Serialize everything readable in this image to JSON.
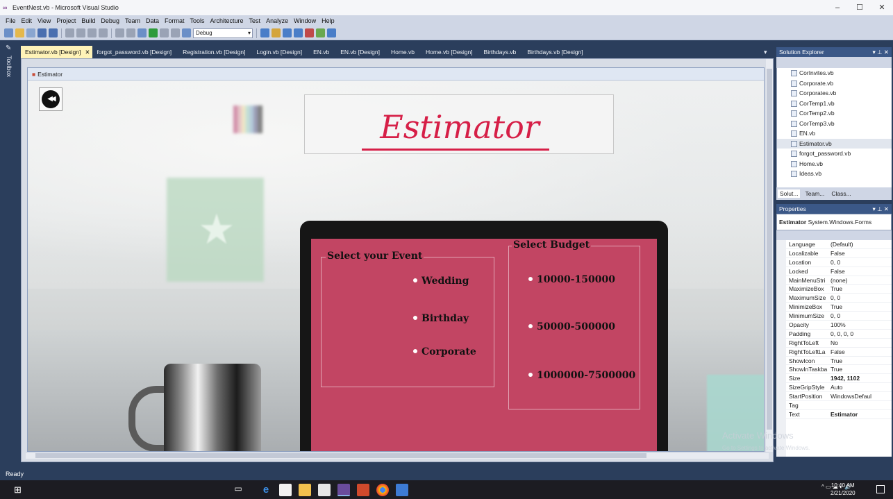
{
  "window": {
    "title": "EventNest.vb - Microsoft Visual Studio",
    "controls": [
      "–",
      "☐",
      "✕"
    ]
  },
  "menu": [
    "File",
    "Edit",
    "View",
    "Project",
    "Build",
    "Debug",
    "Team",
    "Data",
    "Format",
    "Tools",
    "Architecture",
    "Test",
    "Analyze",
    "Window",
    "Help"
  ],
  "toolbar": {
    "config": "Debug"
  },
  "toolbox_label": "Toolbox",
  "tabs": [
    {
      "label": "Estimator.vb [Design]",
      "active": true
    },
    {
      "label": "forgot_password.vb [Design]"
    },
    {
      "label": "Registration.vb [Design]"
    },
    {
      "label": "Login.vb [Design]"
    },
    {
      "label": "EN.vb"
    },
    {
      "label": "EN.vb [Design]"
    },
    {
      "label": "Home.vb"
    },
    {
      "label": "Home.vb [Design]"
    },
    {
      "label": "Birthdays.vb"
    },
    {
      "label": "Birthdays.vb [Design]"
    }
  ],
  "form": {
    "window_title": "Estimator",
    "heading": "Estimator",
    "event_group": {
      "legend": "Select your Event",
      "options": [
        "Wedding",
        "Birthday",
        "Corporate"
      ]
    },
    "budget_group": {
      "legend": "Select Budget",
      "options": [
        "10000-150000",
        "50000-500000",
        "1000000-7500000"
      ]
    }
  },
  "solution_explorer": {
    "title": "Solution Explorer",
    "items": [
      "CorInvites.vb",
      "Corporate.vb",
      "Corporates.vb",
      "CorTemp1.vb",
      "CorTemp2.vb",
      "CorTemp3.vb",
      "EN.vb",
      "Estimator.vb",
      "forgot_password.vb",
      "Home.vb",
      "Ideas.vb"
    ],
    "selected": "Estimator.vb",
    "bottom_tabs": [
      "Solut...",
      "Team...",
      "Class..."
    ]
  },
  "properties": {
    "title": "Properties",
    "object_name": "Estimator",
    "object_type": "System.Windows.Forms",
    "rows": [
      {
        "name": "Language",
        "value": "(Default)"
      },
      {
        "name": "Localizable",
        "value": "False"
      },
      {
        "name": "Location",
        "value": "0, 0"
      },
      {
        "name": "Locked",
        "value": "False"
      },
      {
        "name": "MainMenuStri",
        "value": "(none)"
      },
      {
        "name": "MaximizeBox",
        "value": "True"
      },
      {
        "name": "MaximumSize",
        "value": "0, 0"
      },
      {
        "name": "MinimizeBox",
        "value": "True"
      },
      {
        "name": "MinimumSize",
        "value": "0, 0"
      },
      {
        "name": "Opacity",
        "value": "100%"
      },
      {
        "name": "Padding",
        "value": "0, 0, 0, 0"
      },
      {
        "name": "RightToLeft",
        "value": "No"
      },
      {
        "name": "RightToLeftLa",
        "value": "False"
      },
      {
        "name": "ShowIcon",
        "value": "True"
      },
      {
        "name": "ShowInTaskba",
        "value": "True"
      },
      {
        "name": "Size",
        "value": "1942, 1102",
        "bold": true
      },
      {
        "name": "SizeGripStyle",
        "value": "Auto"
      },
      {
        "name": "StartPosition",
        "value": "WindowsDefaul"
      },
      {
        "name": "Tag",
        "value": ""
      },
      {
        "name": "Text",
        "value": "Estimator",
        "bold": true
      }
    ]
  },
  "watermark": {
    "line1": "Activate Windows",
    "line2": "Go to Settings to activate Windows."
  },
  "status": "Ready",
  "taskbar": {
    "time": "10:40 AM",
    "date": "2/21/2020",
    "icons": [
      "task-view-icon",
      "edge-icon",
      "store-icon",
      "file-explorer-icon",
      "mail-icon",
      "visual-studio-icon",
      "powerpoint-icon",
      "chrome-icon",
      "app-icon"
    ]
  }
}
